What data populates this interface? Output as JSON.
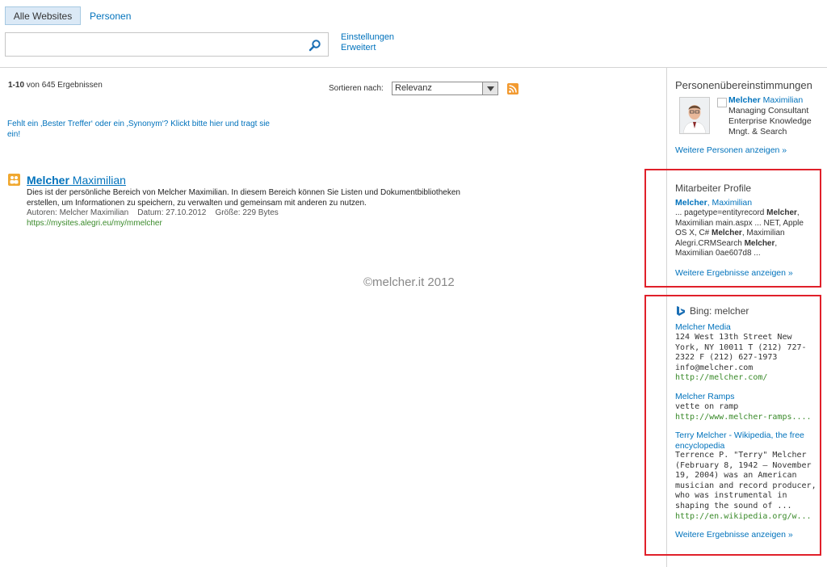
{
  "header": {
    "tabs": [
      {
        "label": "Alle Websites",
        "selected": true
      },
      {
        "label": "Personen",
        "selected": false
      }
    ],
    "search": {
      "value": "",
      "placeholder": ""
    },
    "links": {
      "settings": "Einstellungen",
      "advanced": "Erweitert"
    }
  },
  "results": {
    "count_range": "1-10",
    "count_text": "von 645 Ergebnissen",
    "sort_label": "Sortieren nach:",
    "sort_value": "Relevanz",
    "best_bet_prompt": "Fehlt ein ‚Bester Treffer‘ oder ein ‚Synonym‘? Klickt bitte hier und tragt sie ein!",
    "items": [
      {
        "title_bold": "Melcher",
        "title_rest": " Maximilian",
        "description": "Dies ist der persönliche Bereich von Melcher Maximilian. In diesem Bereich können Sie Listen und Dokumentbibliotheken erstellen, um Informationen zu speichern, zu verwalten und gemeinsam mit anderen zu nutzen.",
        "meta": "Autoren: Melcher Maximilian    Datum: 27.10.2012    Größe: 229 Bytes",
        "url": "https://mysites.alegri.eu/my/mmelcher"
      }
    ]
  },
  "watermark": "©melcher.it 2012",
  "people_matches": {
    "title": "Personenübereinstimmungen",
    "person": {
      "name_bold": "Melcher",
      "name_rest": " Maximilian",
      "line1": "Managing Consultant",
      "line2": "Enterprise Knowledge",
      "line3": "Mngt. & Search"
    },
    "more": "Weitere Personen anzeigen »"
  },
  "profile_panel": {
    "title": "Mitarbeiter Profile",
    "link_bold": "Melcher",
    "link_rest": ", Maximilian",
    "snippet_parts": [
      {
        "t": "... pagetype=entityrecord ",
        "b": false
      },
      {
        "t": "Melcher",
        "b": true
      },
      {
        "t": ", Maximilian main.aspx ... NET, Apple OS X, C# ",
        "b": false
      },
      {
        "t": "Melcher",
        "b": true
      },
      {
        "t": ", Maximilian Alegri.CRMSearch ",
        "b": false
      },
      {
        "t": "Melcher",
        "b": true
      },
      {
        "t": ", Maximilian 0ae607d8 ...",
        "b": false
      }
    ],
    "more": "Weitere Ergebnisse anzeigen »"
  },
  "bing_panel": {
    "title": "Bing: melcher",
    "items": [
      {
        "title": "Melcher Media",
        "text": "124 West 13th Street New York, NY 10011 T (212) 727-2322 F (212) 627-1973 info@melcher.com",
        "url": "http://melcher.com/"
      },
      {
        "title": "Melcher Ramps",
        "text": "vette on ramp",
        "url": "http://www.melcher-ramps...."
      },
      {
        "title": "Terry Melcher - Wikipedia, the free encyclopedia",
        "text": "Terrence P. \"Terry\" Melcher (February 8, 1942 – November 19, 2004) was an American musician and record producer, who was instrumental in shaping the sound of ...",
        "url": "http://en.wikipedia.org/w..."
      }
    ],
    "more": "Weitere Ergebnisse anzeigen »"
  },
  "colors": {
    "link": "#0072bc",
    "url_green": "#3a8a2a",
    "highlight_box": "#e0202a",
    "tab_selected_bg": "#dbe9f6"
  },
  "icons": {
    "search": "magnifier-icon",
    "rss": "rss-icon",
    "result": "mysite-icon",
    "bing": "bing-logo-icon"
  }
}
